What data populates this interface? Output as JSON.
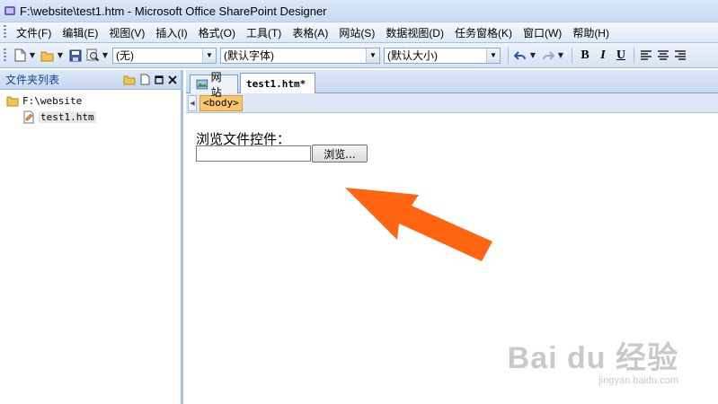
{
  "window": {
    "title": "F:\\website\\test1.htm - Microsoft Office SharePoint Designer"
  },
  "menu": [
    {
      "label": "文件(F)"
    },
    {
      "label": "编辑(E)"
    },
    {
      "label": "视图(V)"
    },
    {
      "label": "插入(I)"
    },
    {
      "label": "格式(O)"
    },
    {
      "label": "工具(T)"
    },
    {
      "label": "表格(A)"
    },
    {
      "label": "网站(S)"
    },
    {
      "label": "数据视图(D)"
    },
    {
      "label": "任务窗格(K)"
    },
    {
      "label": "窗口(W)"
    },
    {
      "label": "帮助(H)"
    }
  ],
  "toolbar": {
    "style_value": "(无)",
    "font_value": "(默认字体)",
    "size_value": "(默认大小)",
    "bold": "B",
    "italic": "I",
    "underline": "U"
  },
  "folder_pane": {
    "title": "文件夹列表",
    "root": "F:\\website",
    "file": "test1.htm"
  },
  "tabs": {
    "site": "网站",
    "document": "test1.htm*"
  },
  "tag_selector": {
    "tag": "<body>"
  },
  "page": {
    "label": "浏览文件控件：",
    "browse_button": "浏览..."
  },
  "watermark": {
    "main": "Bai du 经验",
    "sub": "jingyan.baidu.com"
  },
  "colors": {
    "accent_arrow": "#ff6410",
    "pane_header_text": "#15428b"
  }
}
